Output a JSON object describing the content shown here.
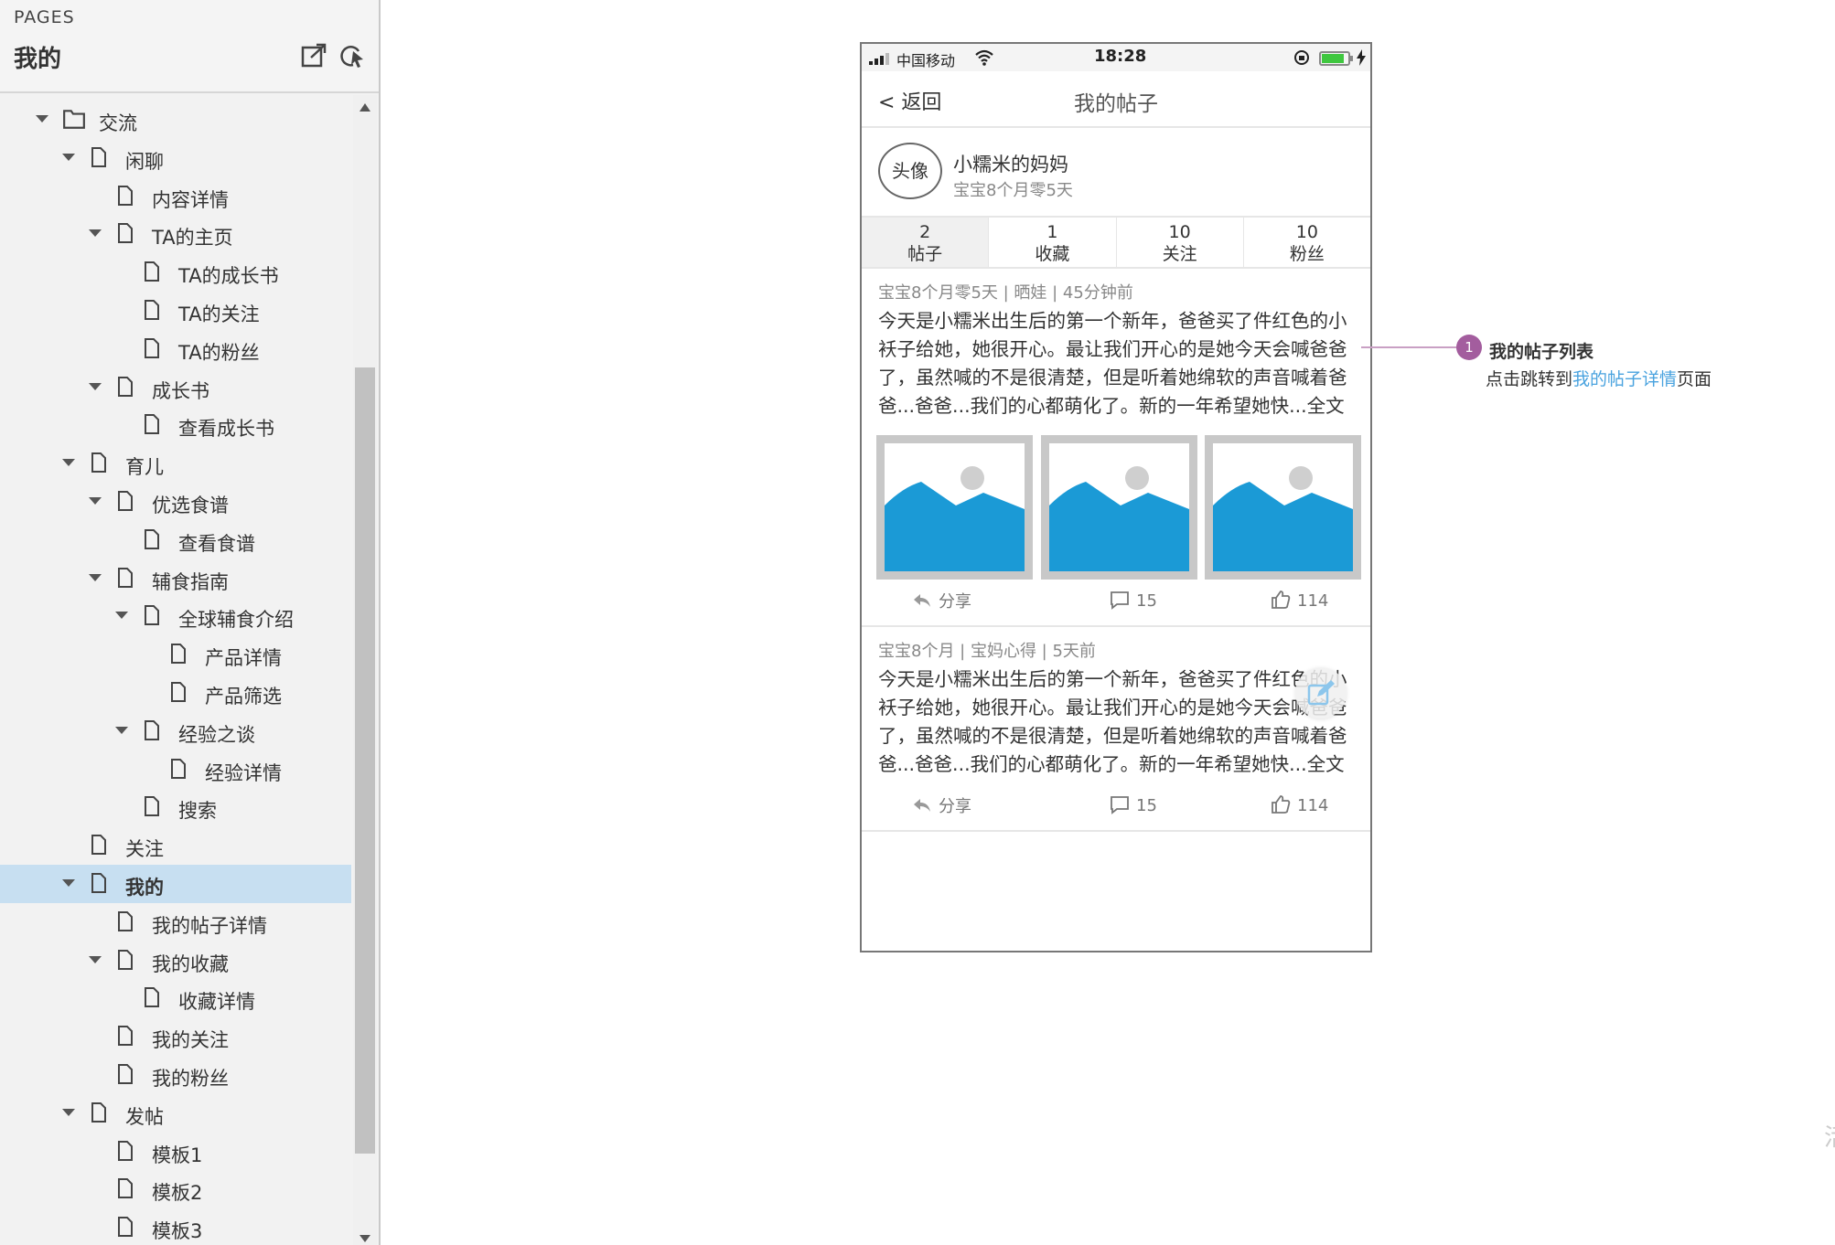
{
  "sidebar": {
    "caption": "PAGES",
    "title": "我的",
    "items": [
      {
        "label": "交流",
        "depth": 0,
        "type": "folder",
        "expanded": true
      },
      {
        "label": "闲聊",
        "depth": 1,
        "type": "page",
        "expanded": true
      },
      {
        "label": "内容详情",
        "depth": 2,
        "type": "page"
      },
      {
        "label": "TA的主页",
        "depth": 2,
        "type": "page",
        "expanded": true
      },
      {
        "label": "TA的成长书",
        "depth": 3,
        "type": "page"
      },
      {
        "label": "TA的关注",
        "depth": 3,
        "type": "page"
      },
      {
        "label": "TA的粉丝",
        "depth": 3,
        "type": "page"
      },
      {
        "label": "成长书",
        "depth": 2,
        "type": "page",
        "expanded": true
      },
      {
        "label": "查看成长书",
        "depth": 3,
        "type": "page"
      },
      {
        "label": "育儿",
        "depth": 1,
        "type": "page",
        "expanded": true
      },
      {
        "label": "优选食谱",
        "depth": 2,
        "type": "page",
        "expanded": true
      },
      {
        "label": "查看食谱",
        "depth": 3,
        "type": "page"
      },
      {
        "label": "辅食指南",
        "depth": 2,
        "type": "page",
        "expanded": true
      },
      {
        "label": "全球辅食介绍",
        "depth": 3,
        "type": "page",
        "expanded": true
      },
      {
        "label": "产品详情",
        "depth": 4,
        "type": "page"
      },
      {
        "label": "产品筛选",
        "depth": 4,
        "type": "page"
      },
      {
        "label": "经验之谈",
        "depth": 3,
        "type": "page",
        "expanded": true
      },
      {
        "label": "经验详情",
        "depth": 4,
        "type": "page"
      },
      {
        "label": "搜索",
        "depth": 3,
        "type": "page"
      },
      {
        "label": "关注",
        "depth": 1,
        "type": "page"
      },
      {
        "label": "我的",
        "depth": 1,
        "type": "page",
        "expanded": true,
        "selected": true
      },
      {
        "label": "我的帖子详情",
        "depth": 2,
        "type": "page"
      },
      {
        "label": "我的收藏",
        "depth": 2,
        "type": "page",
        "expanded": true
      },
      {
        "label": "收藏详情",
        "depth": 3,
        "type": "page"
      },
      {
        "label": "我的关注",
        "depth": 2,
        "type": "page"
      },
      {
        "label": "我的粉丝",
        "depth": 2,
        "type": "page"
      },
      {
        "label": "发帖",
        "depth": 1,
        "type": "page",
        "expanded": true
      },
      {
        "label": "模板1",
        "depth": 2,
        "type": "page"
      },
      {
        "label": "模板2",
        "depth": 2,
        "type": "page"
      },
      {
        "label": "模板3",
        "depth": 2,
        "type": "page"
      }
    ],
    "selected_color": "#c7dff1"
  },
  "phone": {
    "status": {
      "carrier": "中国移动",
      "time": "18:28",
      "battery_level": 0.85
    },
    "nav": {
      "back": "< 返回",
      "title": "我的帖子"
    },
    "profile": {
      "avatar": "头像",
      "name": "小糯米的妈妈",
      "age": "宝宝8个月零5天"
    },
    "stats": [
      {
        "count": "2",
        "label": "帖子"
      },
      {
        "count": "1",
        "label": "收藏"
      },
      {
        "count": "10",
        "label": "关注"
      },
      {
        "count": "10",
        "label": "粉丝"
      }
    ],
    "posts": [
      {
        "meta": "宝宝8个月零5天 |  晒娃  |  45分钟前",
        "body": "今天是小糯米出生后的第一个新年，爸爸买了件红色的小袄子给她，她很开心。最让我们开心的是她今天会喊爸爸了，虽然喊的不是很清楚，但是听着她绵软的声音喊着爸爸...爸爸...我们的心都萌化了。新的一年希望她快...全文",
        "share": "分享",
        "comments": "15",
        "likes": "114"
      },
      {
        "meta": "宝宝8个月 |  宝妈心得  |  5天前",
        "body": "今天是小糯米出生后的第一个新年，爸爸买了件红色的小袄子给她，她很开心。最让我们开心的是她今天会喊爸爸了，虽然喊的不是很清楚，但是听着她绵软的声音喊着爸爸...爸爸...我们的心都萌化了。新的一年希望她快...全文",
        "share": "分享",
        "comments": "15",
        "likes": "114"
      }
    ],
    "image_color": "#1b9ad6"
  },
  "annotation": {
    "number": "1",
    "title": "我的帖子列表",
    "desc_prefix": "点击跳转到",
    "desc_link": "我的帖子详情",
    "desc_suffix": "页面",
    "badge_color": "#a35d9e",
    "link_color": "#4aa3df"
  },
  "corner_mark": "活"
}
